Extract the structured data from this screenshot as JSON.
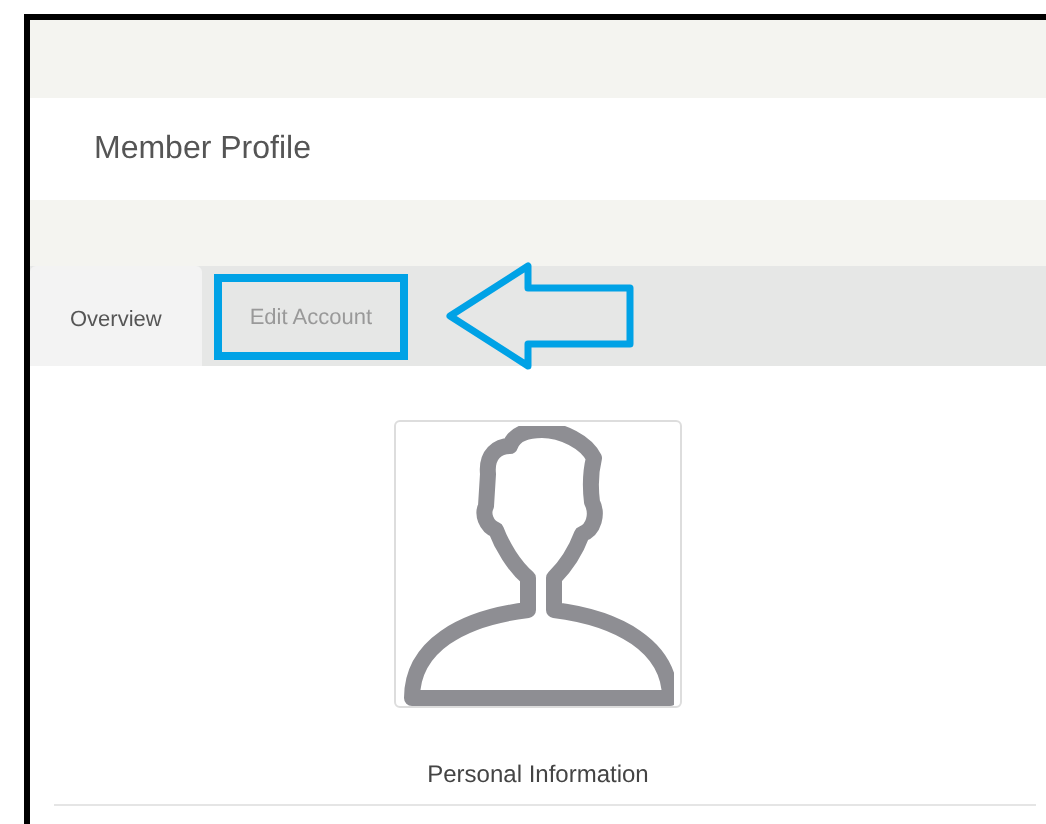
{
  "page": {
    "title": "Member Profile"
  },
  "tabs": [
    {
      "label": "Overview",
      "selected": true,
      "highlighted": false
    },
    {
      "label": "Edit Account",
      "selected": false,
      "highlighted": true
    }
  ],
  "profile": {
    "section_title": "Personal Information"
  }
}
